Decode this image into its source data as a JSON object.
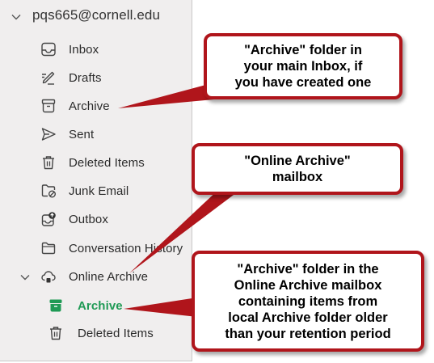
{
  "account": {
    "email": "pqs665@cornell.edu"
  },
  "folders": [
    {
      "label": "Inbox",
      "icon": "inbox-icon"
    },
    {
      "label": "Drafts",
      "icon": "drafts-pencil-icon"
    },
    {
      "label": "Archive",
      "icon": "archive-box-icon"
    },
    {
      "label": "Sent",
      "icon": "sent-paper-plane-icon"
    },
    {
      "label": "Deleted Items",
      "icon": "trash-icon"
    },
    {
      "label": "Junk Email",
      "icon": "junk-folder-icon"
    },
    {
      "label": "Outbox",
      "icon": "outbox-icon"
    },
    {
      "label": "Conversation History",
      "icon": "folder-icon"
    }
  ],
  "online_archive": {
    "label": "Online Archive",
    "icon": "cloud-archive-icon",
    "children": [
      {
        "label": "Archive",
        "icon": "archive-box-icon",
        "selected": true
      },
      {
        "label": "Deleted Items",
        "icon": "trash-icon"
      }
    ]
  },
  "callouts": {
    "main_archive": {
      "lines": [
        "\"Archive\" folder in",
        "your main Inbox, if",
        "you have created one"
      ]
    },
    "online_archive_mailbox": {
      "lines": [
        "\"Online Archive\"",
        "mailbox"
      ]
    },
    "online_archive_folder": {
      "lines": [
        "\"Archive\" folder in the",
        "Online Archive mailbox",
        "containing items from",
        "local Archive folder older",
        "than your retention period"
      ]
    }
  },
  "colors": {
    "pane_background": "#f0eeee",
    "selected_text": "#1f9a55",
    "callout_border": "#b0151b",
    "arrow_fill": "#b0151b"
  }
}
